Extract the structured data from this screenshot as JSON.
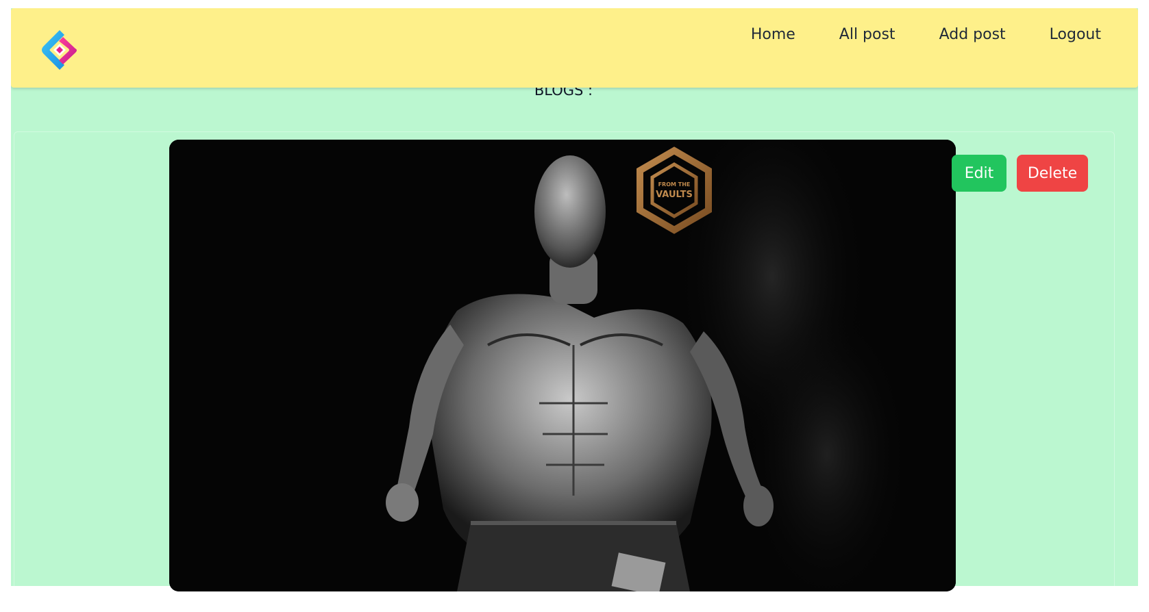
{
  "navbar": {
    "logo_icon": "diamond-logo-icon",
    "links": [
      {
        "label": "Home"
      },
      {
        "label": "All post"
      },
      {
        "label": "Add post"
      },
      {
        "label": "Logout"
      }
    ]
  },
  "main": {
    "heading": "BLOGS :",
    "posts": [
      {
        "image_watermark_text": "FROM THE VAULTS",
        "actions": {
          "edit_label": "Edit",
          "delete_label": "Delete"
        }
      }
    ]
  },
  "colors": {
    "navbar_bg": "#fef08a",
    "page_bg": "#bbf7d0",
    "edit_button": "#22c55e",
    "delete_button": "#ef4444"
  }
}
